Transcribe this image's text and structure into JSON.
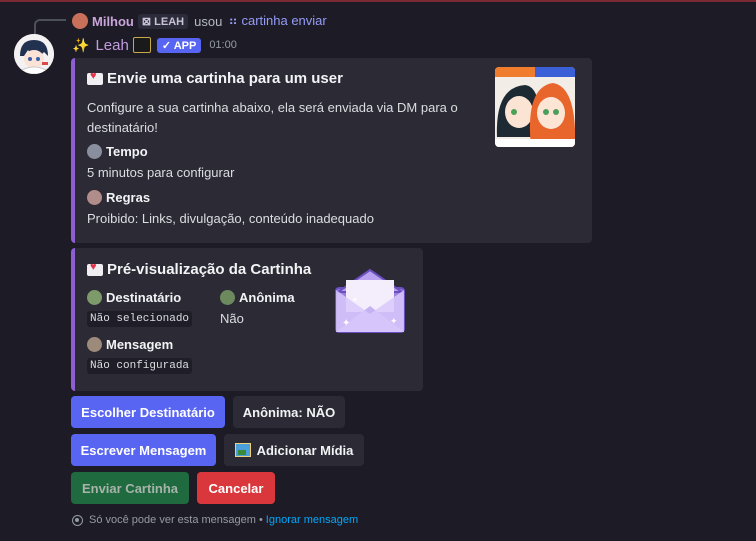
{
  "reply": {
    "username": "Milhou",
    "tag": "LEAH",
    "action": "usou",
    "command": "cartinha enviar"
  },
  "message": {
    "author": "Leah",
    "app_badge": "APP",
    "app_check": "✓",
    "timestamp": "01:00"
  },
  "embed_info": {
    "title": "Envie uma cartinha para um user",
    "description": "Configure a sua cartinha abaixo, ela será enviada via DM para o destinatário!",
    "fields": [
      {
        "name": "Tempo",
        "value": "5 minutos para configurar"
      },
      {
        "name": "Regras",
        "value": "Proibido: Links, divulgação, conteúdo inadequado"
      }
    ]
  },
  "embed_preview": {
    "title": "Pré-visualização da Cartinha",
    "fields": [
      {
        "name": "Destinatário",
        "value": "Não selecionado"
      },
      {
        "name": "Anônima",
        "value": "Não"
      },
      {
        "name": "Mensagem",
        "value": "Não configurada"
      }
    ]
  },
  "buttons": {
    "choose_recipient": "Escolher Destinatário",
    "anonymous": "Anônima: NÃO",
    "write_message": "Escrever Mensagem",
    "add_media": "Adicionar Mídia",
    "send": "Enviar Cartinha",
    "cancel": "Cancelar"
  },
  "footer": {
    "notice": "Só você pode ver esta mensagem",
    "separator": "•",
    "dismiss": "Ignorar mensagem"
  },
  "colors": {
    "embed_accent": "#8d5fd3",
    "primary": "#5865f2",
    "success": "#1f6b3f",
    "danger": "#da373c",
    "link": "#00a8fc"
  }
}
